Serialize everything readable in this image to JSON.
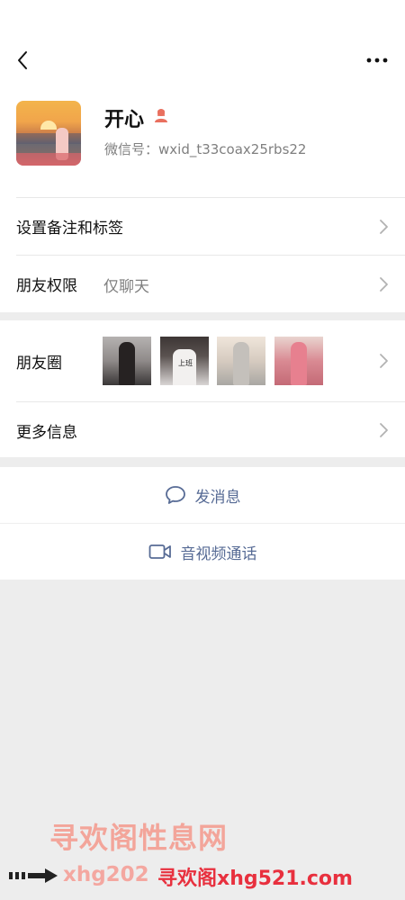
{
  "profile": {
    "nickname": "开心",
    "wechat_id": "微信号：wxid_t33coax25rbs22",
    "gender": "female"
  },
  "settings": {
    "remark_tags_label": "设置备注和标签",
    "permissions_label": "朋友权限",
    "permissions_value": "仅聊天"
  },
  "moments": {
    "label": "朋友圈",
    "thumb2_text": "上班",
    "more_info_label": "更多信息"
  },
  "actions": {
    "message_label": "发消息",
    "video_call_label": "音视频通话"
  },
  "watermark": {
    "title": "寻欢阁性息网",
    "left_text": "xhg202",
    "site": "寻欢阁xhg521.com"
  },
  "colors": {
    "link_blue": "#576b95",
    "gender_female": "#e9705f",
    "background": "#ededed"
  },
  "icons": {
    "back": "chevron-left-icon",
    "more": "more-dots-icon",
    "gender": "female-user-icon",
    "chevron": "chevron-right-icon",
    "message": "chat-bubble-icon",
    "video": "video-camera-icon"
  }
}
